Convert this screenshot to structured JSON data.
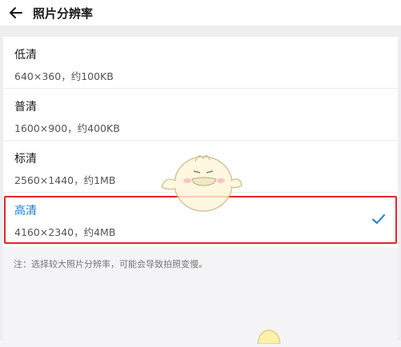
{
  "header": {
    "title": "照片分辨率",
    "back_icon": "back-arrow-icon"
  },
  "options": [
    {
      "name": "低清",
      "desc": "640×360，约100KB",
      "selected": false
    },
    {
      "name": "普清",
      "desc": "1600×900，约400KB",
      "selected": false
    },
    {
      "name": "标清",
      "desc": "2560×1440，约1MB",
      "selected": false
    },
    {
      "name": "高清",
      "desc": "4160×2340，约4MB",
      "selected": true
    }
  ],
  "note": "注：选择较大照片分辨率，可能会导致拍照变慢。",
  "colors": {
    "accent": "#1a7fd2",
    "highlight_border": "#e3262b",
    "background": "#f4f4f6"
  },
  "icons": {
    "selected_check": "checkmark-icon",
    "mascot": "mascot-sticker"
  }
}
